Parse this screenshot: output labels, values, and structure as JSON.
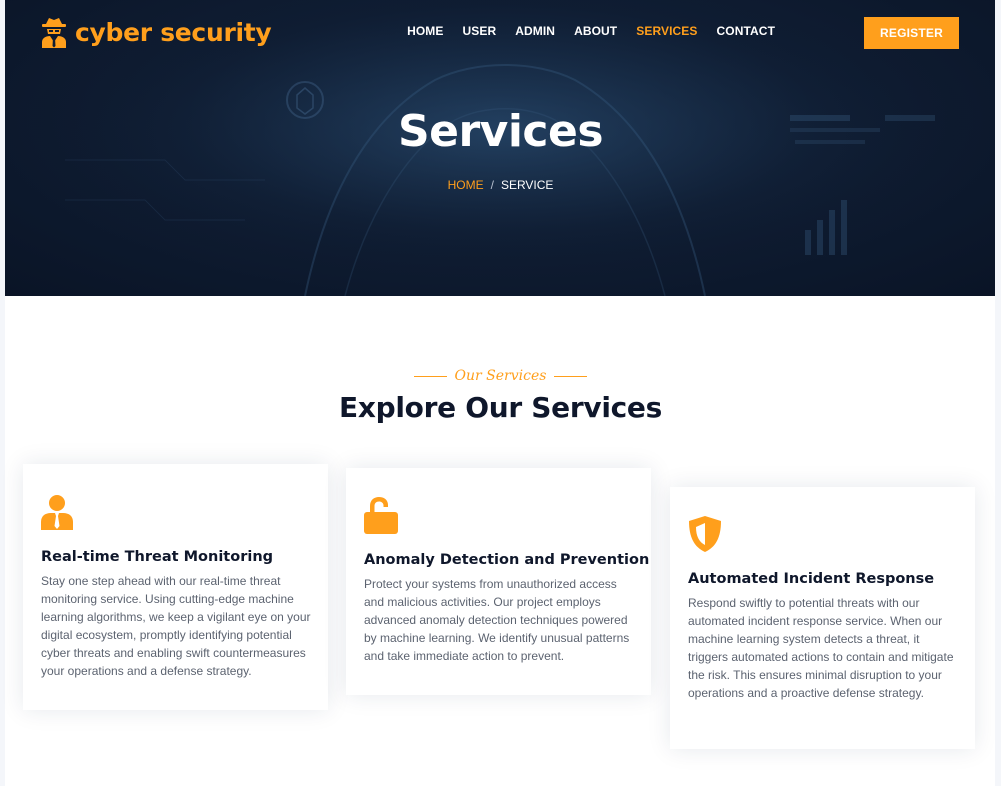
{
  "brand": {
    "name": "cyber security",
    "logo_icon": "spy-agent-icon"
  },
  "nav": {
    "items": [
      {
        "label": "HOME",
        "active": false
      },
      {
        "label": "USER",
        "active": false
      },
      {
        "label": "ADMIN",
        "active": false
      },
      {
        "label": "ABOUT",
        "active": false
      },
      {
        "label": "SERVICES",
        "active": true
      },
      {
        "label": "CONTACT",
        "active": false
      }
    ],
    "register_label": "REGISTER"
  },
  "hero": {
    "title": "Services",
    "breadcrumb": {
      "home": "HOME",
      "separator": "/",
      "current": "SERVICE"
    }
  },
  "section": {
    "eyebrow": "Our Services",
    "title": "Explore Our Services"
  },
  "cards": [
    {
      "icon": "user-tie-icon",
      "title": "Real-time Threat Monitoring",
      "text": "Stay one step ahead with our real-time threat monitoring service. Using cutting-edge machine learning algorithms, we keep a vigilant eye on your digital ecosystem, promptly identifying potential cyber threats and enabling swift countermeasures your operations and a defense strategy."
    },
    {
      "icon": "unlock-icon",
      "title": "Anomaly Detection and Prevention",
      "text": "Protect your systems from unauthorized access and malicious activities. Our project employs advanced anomaly detection techniques powered by machine learning. We identify unusual patterns and take immediate action to prevent."
    },
    {
      "icon": "shield-icon",
      "title": "Automated Incident Response",
      "text": "Respond swiftly to potential threats with our automated incident response service. When our machine learning system detects a threat, it triggers automated actions to contain and mitigate the risk. This ensures minimal disruption to your operations and a proactive defense strategy."
    }
  ],
  "colors": {
    "accent": "#ff9f1c",
    "hero_bg": "#0f1d33",
    "heading": "#0f172b",
    "body_text": "#5c6370"
  }
}
